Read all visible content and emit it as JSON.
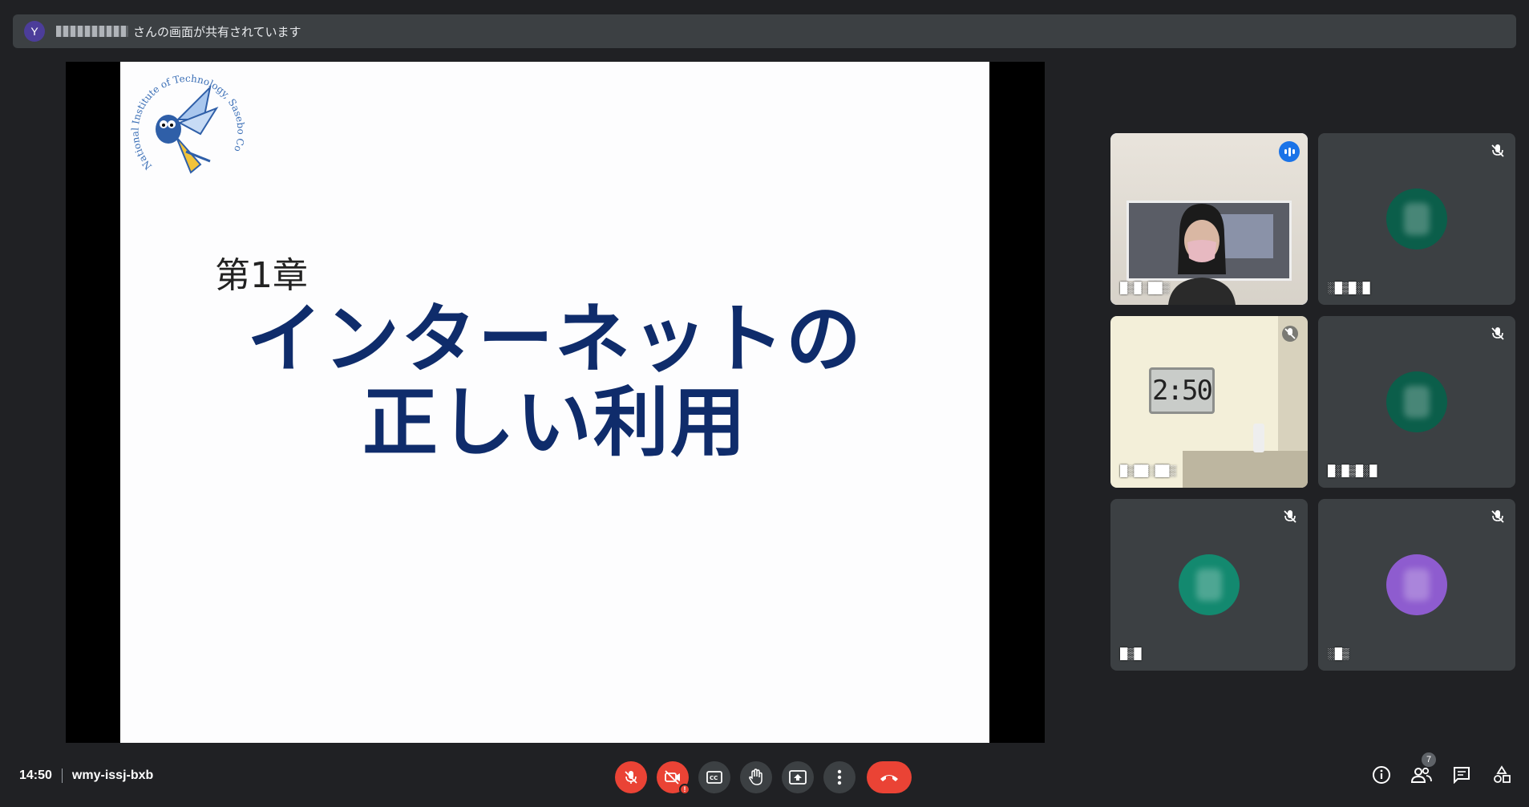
{
  "presenter_bar": {
    "avatar_initial": "Y",
    "sharing_text": "さんの画面が共有されています"
  },
  "slide": {
    "chapter": "第1章",
    "title_line1": "インターネットの",
    "title_line2": "正しい利用",
    "logo_text": "National Institute of Technology, Sasebo College"
  },
  "participants": [
    {
      "id": "p1",
      "state": "speaking",
      "type": "video"
    },
    {
      "id": "p2",
      "state": "muted",
      "type": "avatar",
      "color": "#0b5e4a"
    },
    {
      "id": "p3",
      "state": "muted",
      "type": "video",
      "clock": "2:50"
    },
    {
      "id": "p4",
      "state": "muted",
      "type": "avatar",
      "color": "#0b5e4a"
    },
    {
      "id": "p5",
      "state": "muted",
      "type": "avatar",
      "color": "#13896f"
    },
    {
      "id": "p6",
      "state": "muted",
      "type": "avatar",
      "color": "#8e5ccf"
    }
  ],
  "meeting": {
    "time": "14:50",
    "code": "wmy-issj-bxb"
  },
  "people_count": "7",
  "colors": {
    "background": "#202124",
    "tile": "#3c4043",
    "accent": "#1a73e8",
    "danger": "#ea4335",
    "slide_title": "#0f2c6b"
  }
}
